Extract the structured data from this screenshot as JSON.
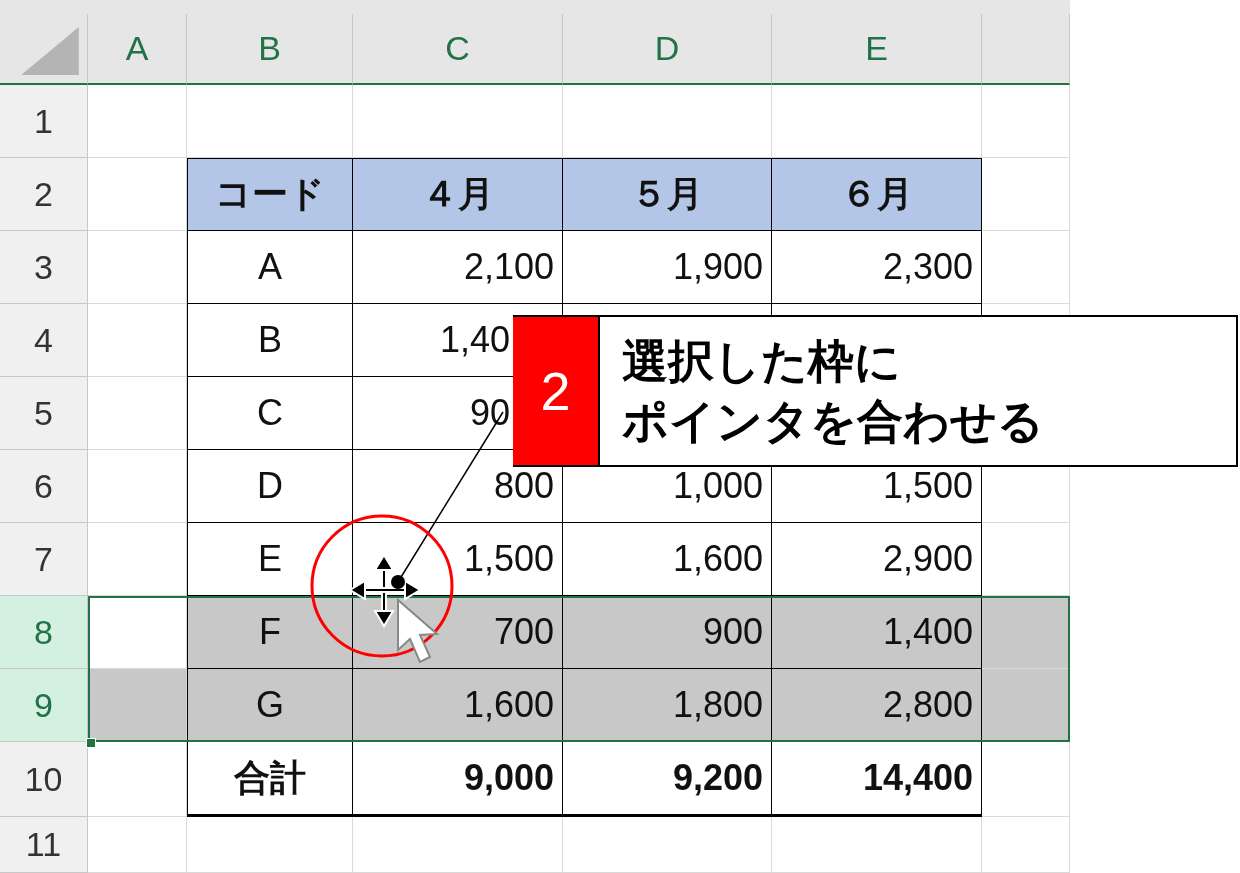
{
  "columns": [
    "A",
    "B",
    "C",
    "D",
    "E"
  ],
  "rows": [
    {
      "label": "1",
      "selected": false,
      "active": false
    },
    {
      "label": "2",
      "selected": false,
      "active": false
    },
    {
      "label": "3",
      "selected": false,
      "active": false
    },
    {
      "label": "4",
      "selected": false,
      "active": false
    },
    {
      "label": "5",
      "selected": false,
      "active": false
    },
    {
      "label": "6",
      "selected": false,
      "active": false
    },
    {
      "label": "7",
      "selected": false,
      "active": false
    },
    {
      "label": "8",
      "selected": true,
      "active": true
    },
    {
      "label": "9",
      "selected": true,
      "active": false
    },
    {
      "label": "10",
      "selected": false,
      "active": false
    },
    {
      "label": "11",
      "selected": false,
      "active": false
    }
  ],
  "table": {
    "header": [
      "コード",
      "４月",
      "５月",
      "６月"
    ],
    "rows": [
      {
        "code": "A",
        "values": [
          "2,100",
          "1,900",
          "2,300"
        ],
        "covered": false
      },
      {
        "code": "B",
        "values": [
          "1,40"
        ],
        "covered": true
      },
      {
        "code": "C",
        "values": [
          "90"
        ],
        "covered": true
      },
      {
        "code": "D",
        "values": [
          "800",
          "1,000",
          "1,500"
        ],
        "covered": false
      },
      {
        "code": "E",
        "values": [
          "1,500",
          "1,600",
          "2,900"
        ],
        "covered": false
      },
      {
        "code": "F",
        "values": [
          "700",
          "900",
          "1,400"
        ],
        "covered": false
      },
      {
        "code": "G",
        "values": [
          "1,600",
          "1,800",
          "2,800"
        ],
        "covered": false
      }
    ],
    "total": {
      "code": "合計",
      "values": [
        "9,000",
        "9,200",
        "14,400"
      ]
    }
  },
  "callout": {
    "number": "2",
    "lines": [
      "選択した枠に",
      "ポインタを合わせる"
    ]
  }
}
